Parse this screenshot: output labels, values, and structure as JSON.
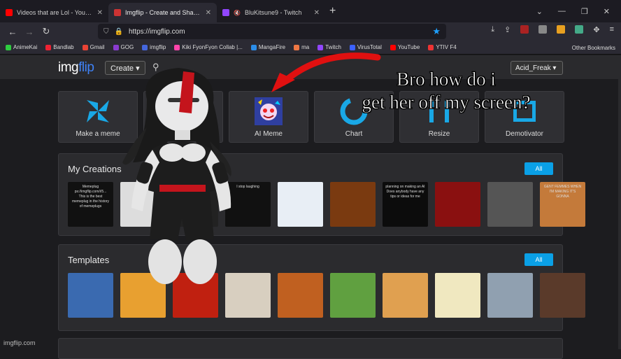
{
  "browser": {
    "tabs": [
      {
        "title": "Videos that are Lol - YouTube",
        "color": "#ff0000",
        "active": false
      },
      {
        "title": "Imgflip - Create and Share Awe",
        "color": "#5a5aff",
        "active": true
      },
      {
        "title": "BluKitsune9 - Twitch",
        "color": "#9146ff",
        "active": false,
        "muted_icon": "🔇"
      }
    ],
    "new_tab": "+",
    "url": "https://imgflip.com",
    "bookmarks": [
      {
        "label": "AnimeKai",
        "color": "#2ecc40"
      },
      {
        "label": "Bandlab",
        "color": "#e23"
      },
      {
        "label": "Gmail",
        "color": "#ea4335"
      },
      {
        "label": "GOG",
        "color": "#8a3bd0"
      },
      {
        "label": "imgflip",
        "color": "#4466dd"
      },
      {
        "label": "Kiki FyonFyon Collab |...",
        "color": "#f4a"
      },
      {
        "label": "MangaFire",
        "color": "#2b8de8"
      },
      {
        "label": "ma",
        "color": "#e74"
      },
      {
        "label": "Twitch",
        "color": "#9146ff"
      },
      {
        "label": "VirusTotal",
        "color": "#3b61ff"
      },
      {
        "label": "YouTube",
        "color": "#ff0000"
      },
      {
        "label": "YTIV F4",
        "color": "#e33"
      }
    ],
    "other_bookmarks": "Other Bookmarks"
  },
  "site": {
    "logo_main": "img",
    "logo_accent": "flip",
    "create_label": "Create ▾",
    "user_label": "Acid_Freak ▾",
    "tools": [
      {
        "label": "Make a meme",
        "icon": "pinwheel-icon",
        "color": "#19a8e6"
      },
      {
        "label": "",
        "icon": "gif-icon",
        "color": "#19a8e6"
      },
      {
        "label": "AI Meme",
        "icon": "ai-robot-icon",
        "color": "#3344aa"
      },
      {
        "label": "Chart",
        "icon": "chart-icon",
        "color": "#19a8e6"
      },
      {
        "label": "Resize",
        "icon": "resize-icon",
        "color": "#19a8e6"
      },
      {
        "label": "Demotivator",
        "icon": "frame-icon",
        "color": "#19a8e6"
      }
    ],
    "my_creations": {
      "title": "My Creations",
      "all_label": "All",
      "thumbs": [
        {
          "text": "Memeplug\nps://imgflip.com/i/5...\nThis is the best memeplug in the history of memeplugs",
          "bg": "#111"
        },
        {
          "text": "",
          "bg": "#ddd"
        },
        {
          "text": "",
          "bg": "#222"
        },
        {
          "text": "I stop laughing",
          "bg": "#111"
        },
        {
          "text": "",
          "bg": "#e8eef5"
        },
        {
          "text": "",
          "bg": "#7a3a10"
        },
        {
          "text": "planning on making an AI\nDoes anybody have any tips or ideas for me",
          "bg": "#0c0c0c"
        },
        {
          "text": "",
          "bg": "#8a1010"
        },
        {
          "text": "",
          "bg": "#555"
        },
        {
          "text": "GENT FEMMES WHEN I'M MAKING IT'S GONNA",
          "bg": "#c47a3a"
        }
      ]
    },
    "templates": {
      "title": "Templates",
      "all_label": "All",
      "thumbs": [
        {
          "bg": "#3a6ab0"
        },
        {
          "bg": "#e8a030"
        },
        {
          "bg": "#c02010"
        },
        {
          "bg": "#d8cfc0"
        },
        {
          "bg": "#c06020"
        },
        {
          "bg": "#60a040"
        },
        {
          "bg": "#e0a050"
        },
        {
          "bg": "#f0e8c0"
        },
        {
          "bg": "#90a0b0"
        },
        {
          "bg": "#5a3a2a"
        }
      ]
    },
    "footer": "imgflip.com"
  },
  "overlay": {
    "caption_line1": "Bro how do i",
    "caption_line2": "get her off my screen?"
  }
}
